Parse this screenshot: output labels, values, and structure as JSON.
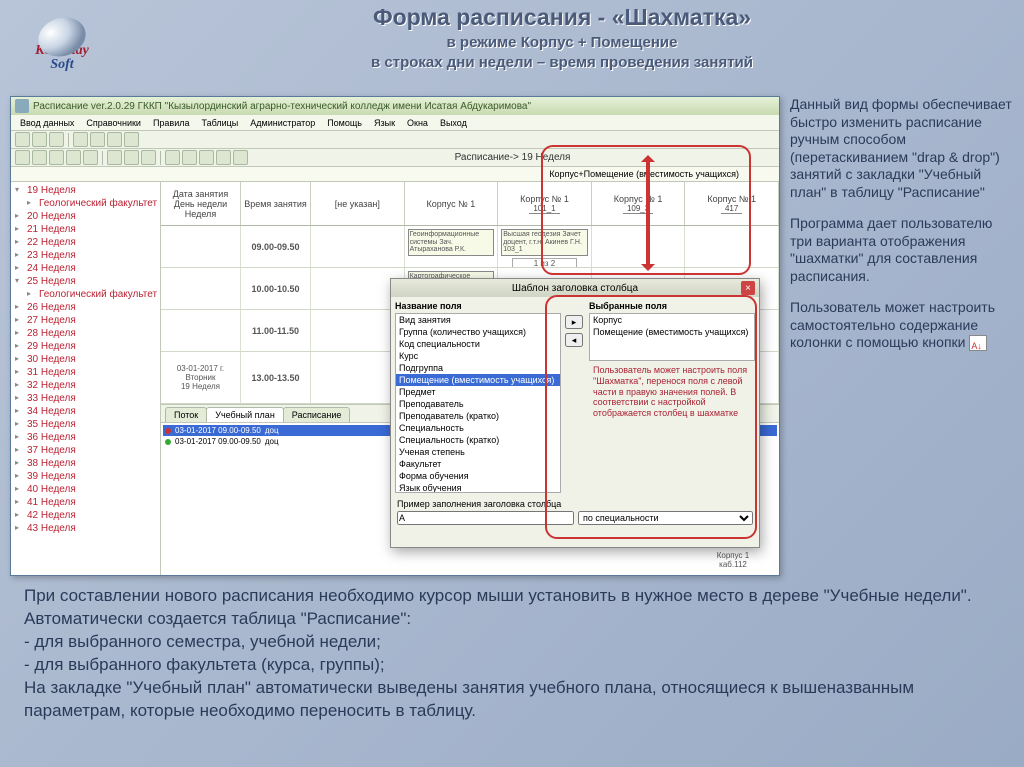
{
  "slide": {
    "title": "Форма расписания - «Шахматка»",
    "sub1": "в режиме Корпус + Помещение",
    "sub2": "в строках дни недели – время проведения занятий"
  },
  "logo": {
    "line1": "Kostanay",
    "line2": "Soft"
  },
  "window": {
    "title": "Расписание ver.2.0.29 ГККП \"Кызылординский аграрно-технический колледж имени Исатая Абдукаримова\"",
    "menu": [
      "Ввод данных",
      "Справочники",
      "Правила",
      "Таблицы",
      "Администратор",
      "Помощь",
      "Язык",
      "Окна",
      "Выход"
    ],
    "sched_title": "Расписание-> 19 Неделя",
    "group_label": "Корпус+Помещение (вместимость учащихся)"
  },
  "tree": [
    {
      "l": "19 Неделя",
      "exp": true
    },
    {
      "l": "Геологический факультет",
      "child": true
    },
    {
      "l": "20 Неделя"
    },
    {
      "l": "21 Неделя"
    },
    {
      "l": "22 Неделя"
    },
    {
      "l": "23 Неделя"
    },
    {
      "l": "24 Неделя"
    },
    {
      "l": "25 Неделя",
      "exp": true
    },
    {
      "l": "Геологический факультет",
      "child": true
    },
    {
      "l": "26 Неделя"
    },
    {
      "l": "27 Неделя"
    },
    {
      "l": "28 Неделя"
    },
    {
      "l": "29 Неделя"
    },
    {
      "l": "30 Неделя"
    },
    {
      "l": "31 Неделя"
    },
    {
      "l": "32 Неделя"
    },
    {
      "l": "33 Неделя"
    },
    {
      "l": "34 Неделя"
    },
    {
      "l": "35 Неделя"
    },
    {
      "l": "36 Неделя"
    },
    {
      "l": "37 Неделя"
    },
    {
      "l": "38 Неделя"
    },
    {
      "l": "39 Неделя"
    },
    {
      "l": "40 Неделя"
    },
    {
      "l": "41 Неделя"
    },
    {
      "l": "42 Неделя"
    },
    {
      "l": "43 Неделя"
    }
  ],
  "grid": {
    "col_left": [
      "Дата занятия",
      "День недели",
      "Неделя"
    ],
    "col_time": "Время занятия",
    "rooms": [
      {
        "n": "[не указан]",
        "c": ""
      },
      {
        "n": "Корпус № 1",
        "c": ""
      },
      {
        "n": "Корпус № 1",
        "c": "101_1"
      },
      {
        "n": "Корпус № 1",
        "c": "109_3"
      },
      {
        "n": "Корпус № 1",
        "c": "417"
      }
    ],
    "rows": [
      {
        "left": "",
        "time": "09.00-09.50",
        "cells": [
          "",
          "Геоинформационные системы Зач. Атыраханова Р.К.",
          "Высшая геодезия Зачет доцент, г.т.н. Акинев Г.Н. 103_1",
          "",
          ""
        ]
      },
      {
        "left": "",
        "time": "10.00-10.50",
        "cells": [
          "",
          "Картографическое черчение Пр. Абдуллина Р.В.",
          "",
          "",
          ""
        ]
      },
      {
        "left": "",
        "time": "11.00-11.50",
        "cells": [
          "",
          "",
          "",
          "",
          ""
        ]
      },
      {
        "left": "03-01-2017 г.\nВторник\n19 Неделя",
        "time": "13.00-13.50",
        "cells": [
          "",
          "",
          "",
          "",
          ""
        ]
      }
    ],
    "pager": "1 из 2"
  },
  "tabs": [
    "Поток",
    "Учебный план",
    "Расписание"
  ],
  "plan_rows": [
    {
      "t": "03-01-2017 09.00-09.50",
      "d": "доц",
      "sel": true,
      "c": "r"
    },
    {
      "t": "03-01-2017 09.00-09.50",
      "d": "доц",
      "sel": false,
      "c": "g"
    }
  ],
  "dialog": {
    "title": "Шаблон заголовка столбца",
    "left_h": "Название поля",
    "right_h": "Выбранные поля",
    "left": [
      "Вид занятия",
      "Группа (количество учащихся)",
      "Код специальности",
      "Курс",
      "Подгруппа",
      "Помещение (вместимость учащихся)",
      "Предмет",
      "Преподаватель",
      "Преподаватель (кратко)",
      "Специальность",
      "Специальность (кратко)",
      "Ученая степень",
      "Факультет",
      "Форма обучения",
      "Язык обучения"
    ],
    "left_sel": 5,
    "right": [
      "Корпус",
      "Помещение (вместимость учащихся)"
    ],
    "note": "Пользователь может настроить поля \"Шахматка\", перенося поля с левой части в правую значения полей. В соответствии с настройкой отображается столбец в шахматке",
    "foot_label": "Пример заполнения заголовка столбца",
    "sample_input": "A",
    "sample_select": "по специальности"
  },
  "room_footer": {
    "n": "Корпус 1",
    "c": "каб.112"
  },
  "side": {
    "p1": "Данный вид формы обеспечивает быстро изменить расписание ручным способом (перетаскиванием \"drap & drop\") занятий с закладки \"Учебный план\" в таблицу \"Расписание\"",
    "p2": "Программа дает пользователю три варианта отображения \"шахматки\" для составления расписания.",
    "p3": "Пользователь может настроить самостоятельно содержание колонки с помощью кнопки"
  },
  "bottom": {
    "l1": "При составлении нового расписания необходимо курсор мыши установить в нужное место в дереве \"Учебные недели\". Автоматически создается таблица \"Расписание\":",
    "l2": "- для выбранного семестра, учебной недели;",
    "l3": "- для выбранного факультета (курса, группы);",
    "l4": "На закладке \"Учебный план\" автоматически выведены занятия учебного плана, относящиеся к вышеназванным параметрам, которые необходимо переносить в таблицу."
  }
}
